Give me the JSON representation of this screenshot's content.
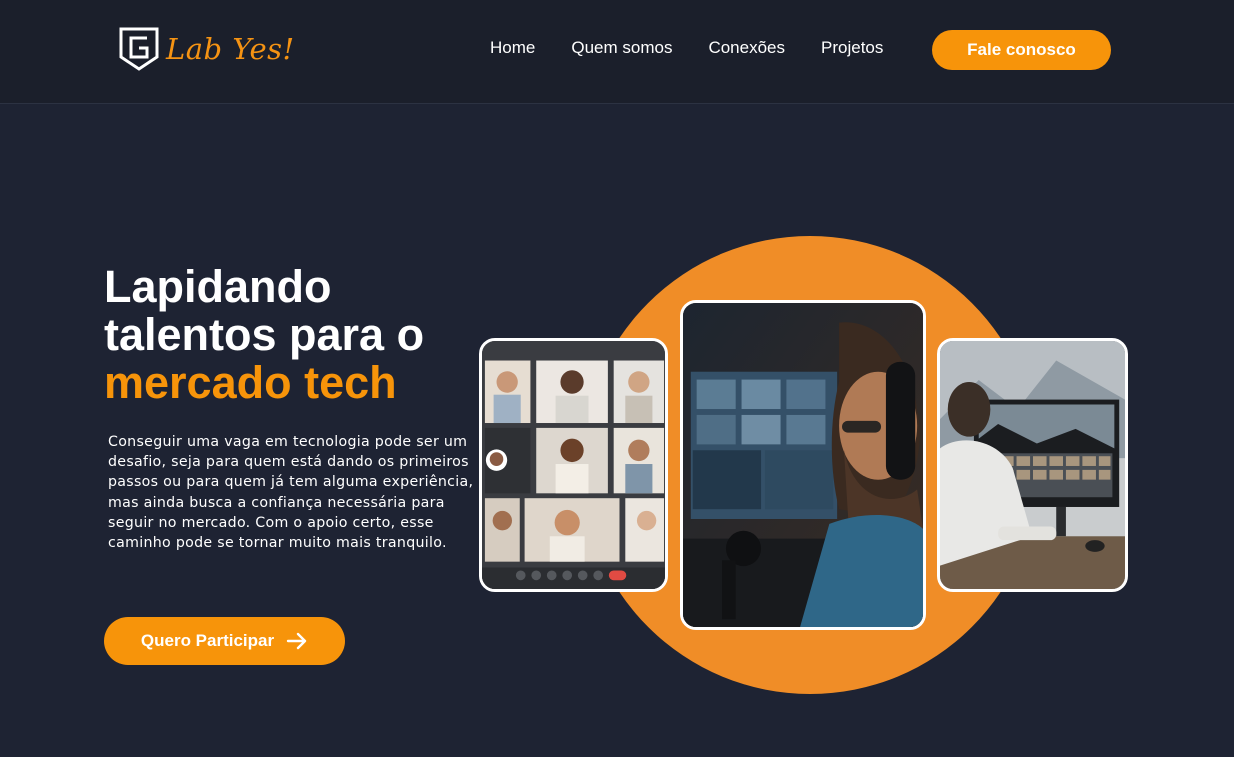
{
  "brand": {
    "name": "Lab Yes!",
    "accent": "#f7940a",
    "logo_icon": "shield-g-logo"
  },
  "nav": {
    "items": [
      "Home",
      "Quem somos",
      "Conexões",
      "Projetos"
    ],
    "cta": "Fale conosco"
  },
  "hero": {
    "title_line1": "Lapidando",
    "title_line2": "talentos para o",
    "title_accent": "mercado tech",
    "description": "Conseguir uma vaga em tecnologia pode ser um desafio, seja para quem está dando os primeiros passos ou para quem já tem alguma experiência, mas ainda busca a confiança necessária para seguir no mercado. Com o apoio certo, esse caminho pode se tornar muito mais tranquilo.",
    "cta_label": "Quero Participar",
    "cta_icon": "arrow-right-icon"
  },
  "images": [
    {
      "name": "video-call-grid",
      "desc": "video call grid"
    },
    {
      "name": "man-headset-monitor",
      "desc": "man with headset"
    },
    {
      "name": "man-desk-monitor",
      "desc": "man at desk"
    }
  ]
}
